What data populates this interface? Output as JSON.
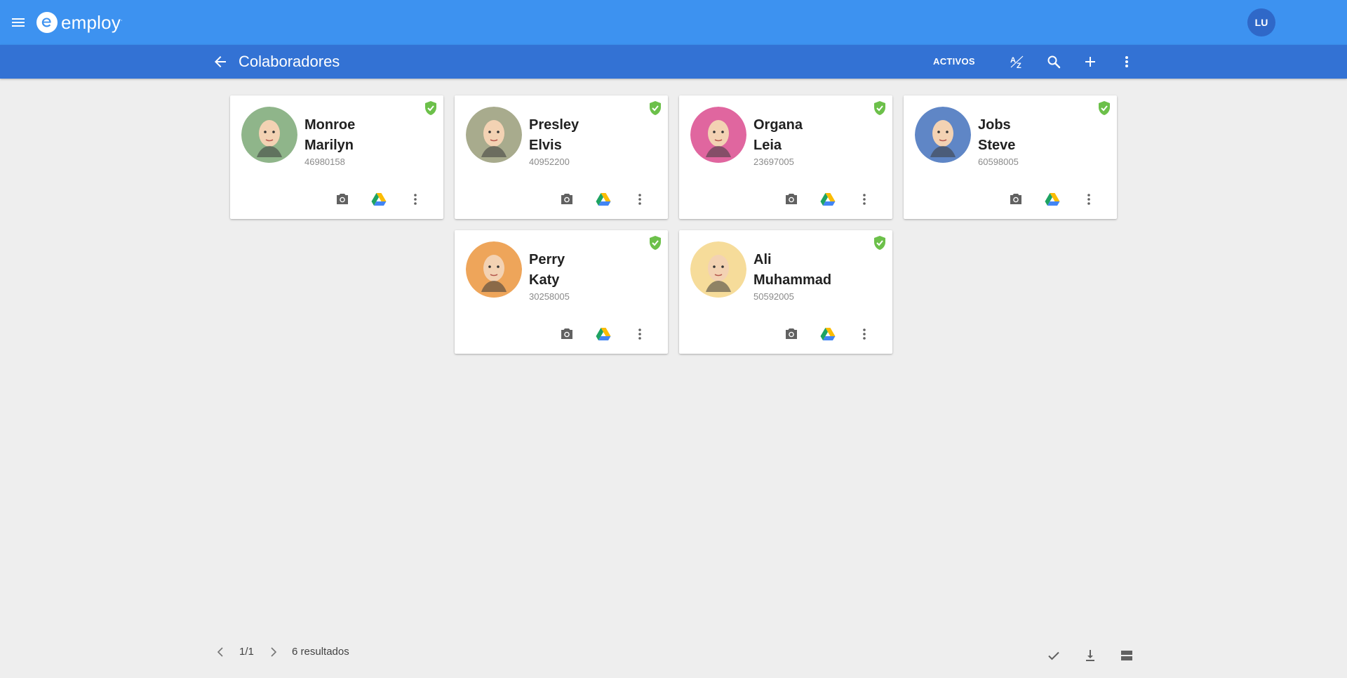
{
  "app": {
    "brand": "employ",
    "user_initials": "LU"
  },
  "toolbar": {
    "title": "Colaboradores",
    "filter_label": "ACTIVOS",
    "icons": [
      "back-arrow-icon",
      "sort-az-icon",
      "search-icon",
      "add-icon",
      "more-vert-icon"
    ]
  },
  "employees": [
    {
      "surname": "Monroe",
      "firstname": "Marilyn",
      "id_number": "46980158",
      "avatar_color": "#8fb58a",
      "verified": true
    },
    {
      "surname": "Presley",
      "firstname": "Elvis",
      "id_number": "40952200",
      "avatar_color": "#a8ab8d",
      "verified": true
    },
    {
      "surname": "Organa",
      "firstname": "Leia",
      "id_number": "23697005",
      "avatar_color": "#e0669f",
      "verified": true
    },
    {
      "surname": "Jobs",
      "firstname": "Steve",
      "id_number": "60598005",
      "avatar_color": "#5f86c6",
      "verified": true
    },
    {
      "surname": "Perry",
      "firstname": "Katy",
      "id_number": "30258005",
      "avatar_color": "#eea55a",
      "verified": true
    },
    {
      "surname": "Ali",
      "firstname": "Muhammad",
      "id_number": "50592005",
      "avatar_color": "#f6dc9a",
      "verified": true
    }
  ],
  "pagination": {
    "page": "1/1",
    "results": "6 resultados"
  },
  "colors": {
    "topbar": "#3d92f0",
    "subbar": "#3372d4",
    "verified_green": "#6cc04a",
    "background": "#eeeeee"
  }
}
